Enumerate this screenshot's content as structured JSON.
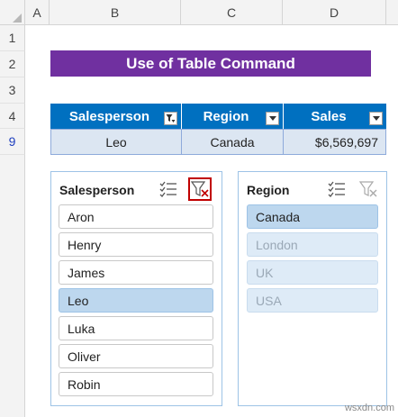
{
  "columns": [
    "A",
    "B",
    "C",
    "D"
  ],
  "rows": [
    "1",
    "2",
    "3",
    "4",
    "9"
  ],
  "title": "Use of Table Command",
  "table": {
    "headers": [
      "Salesperson",
      "Region",
      "Sales"
    ],
    "row": {
      "salesperson": "Leo",
      "region": "Canada",
      "sales": "$6,569,697"
    }
  },
  "slicers": {
    "salesperson": {
      "title": "Salesperson",
      "items": [
        "Aron",
        "Henry",
        "James",
        "Leo",
        "Luka",
        "Oliver",
        "Robin"
      ],
      "selected": "Leo"
    },
    "region": {
      "title": "Region",
      "items": [
        "Canada",
        "London",
        "UK",
        "USA"
      ],
      "selected": "Canada"
    }
  },
  "icons": {
    "multi_select": "multi-select-icon",
    "clear_filter": "clear-filter-icon"
  },
  "colors": {
    "title_bg": "#7030a0",
    "table_header": "#0070c0",
    "table_row": "#dce6f2",
    "selected_item": "#bdd7ee",
    "highlight_border": "#c00000"
  },
  "watermark": "wsxdn.com"
}
